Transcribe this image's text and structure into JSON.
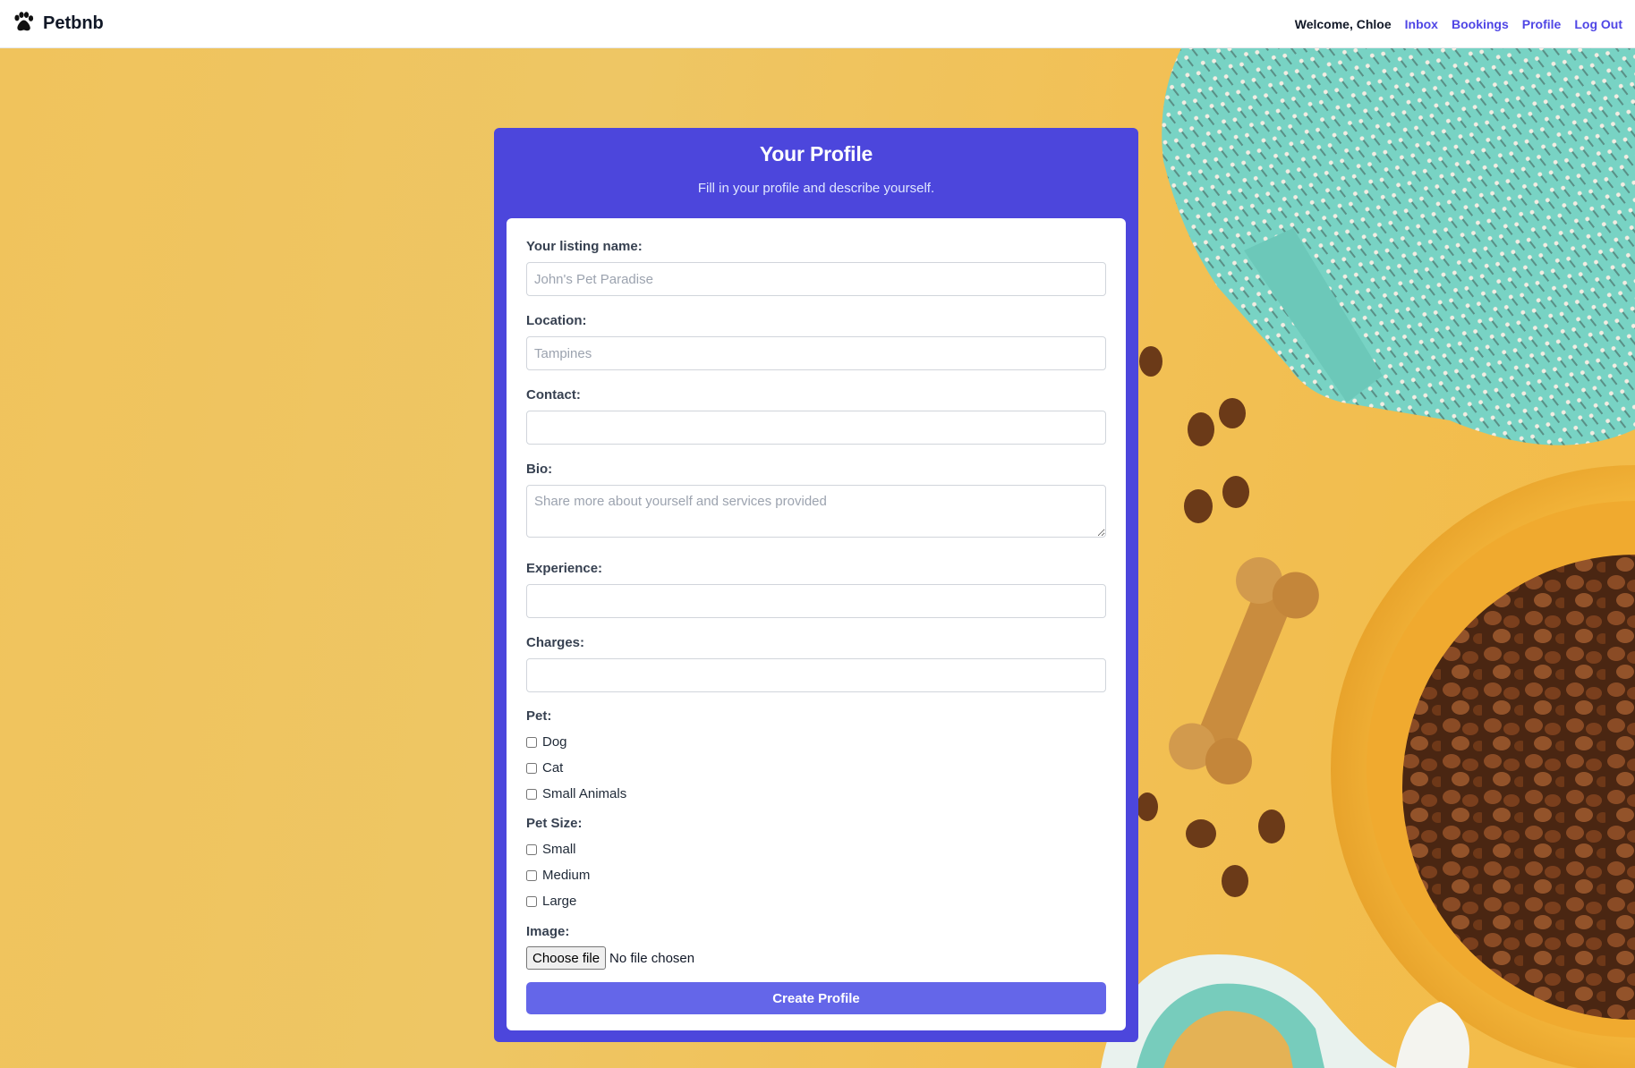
{
  "header": {
    "brand": "Petbnb",
    "brand_icon": "paw-icon",
    "welcome": "Welcome, Chloe",
    "links": [
      "Inbox",
      "Bookings",
      "Profile",
      "Log Out"
    ]
  },
  "card": {
    "title": "Your Profile",
    "subtitle": "Fill in your profile and describe yourself."
  },
  "form": {
    "listing_name": {
      "label": "Your listing name:",
      "placeholder": "John's Pet Paradise",
      "value": ""
    },
    "location": {
      "label": "Location:",
      "placeholder": "Tampines",
      "value": ""
    },
    "contact": {
      "label": "Contact:",
      "placeholder": "",
      "value": ""
    },
    "bio": {
      "label": "Bio:",
      "placeholder": "Share more about yourself and services provided",
      "value": ""
    },
    "experience": {
      "label": "Experience:",
      "placeholder": "",
      "value": ""
    },
    "charges": {
      "label": "Charges:",
      "placeholder": "",
      "value": ""
    },
    "pet": {
      "label": "Pet:",
      "options": [
        "Dog",
        "Cat",
        "Small Animals"
      ]
    },
    "pet_size": {
      "label": "Pet Size:",
      "options": [
        "Small",
        "Medium",
        "Large"
      ]
    },
    "image": {
      "label": "Image:",
      "button": "Choose file",
      "status": "No file chosen"
    },
    "submit": "Create Profile"
  },
  "colors": {
    "primary": "#4c46dc",
    "button": "#6466e9",
    "link": "#4f46e5",
    "background": "#f0c35a"
  }
}
